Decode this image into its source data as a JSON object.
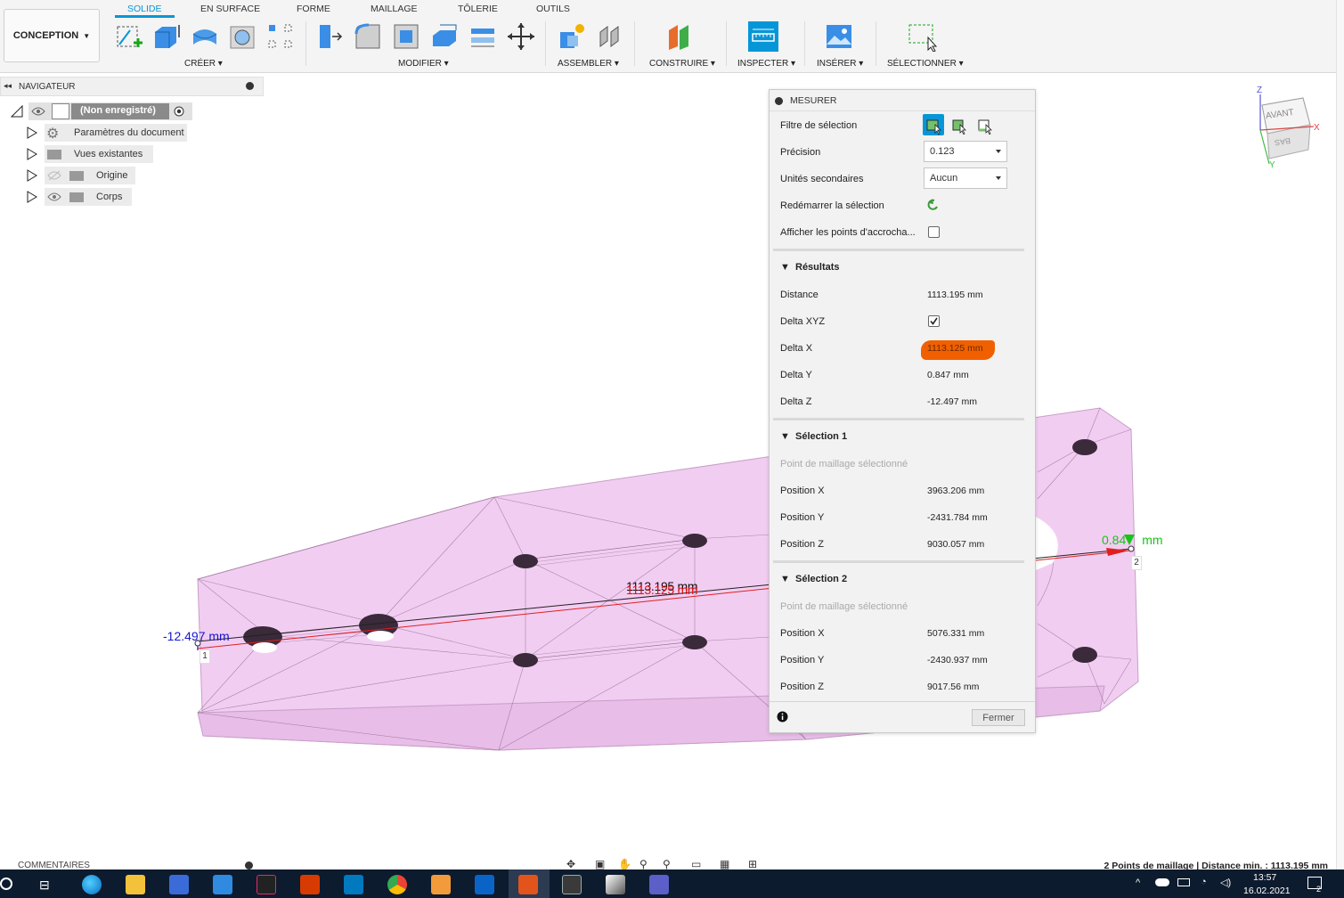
{
  "toolbar": {
    "workspace": "CONCEPTION",
    "tabs": [
      "SOLIDE",
      "EN SURFACE",
      "FORME",
      "MAILLAGE",
      "TÔLERIE",
      "OUTILS"
    ],
    "groups": {
      "create": "CRÉER",
      "modify": "MODIFIER",
      "assemble": "ASSEMBLER",
      "construct": "CONSTRUIRE",
      "inspect": "INSPECTER",
      "insert": "INSÉRER",
      "select": "SÉLECTIONNER"
    }
  },
  "navigator": {
    "title": "NAVIGATEUR",
    "root": "(Non enregistré)",
    "items": [
      "Paramètres du document",
      "Vues existantes",
      "Origine",
      "Corps"
    ]
  },
  "viewcube": {
    "front": "AVANT",
    "bottom": "BAS",
    "axis_z": "Z",
    "axis_x": "X",
    "axis_y": "Y"
  },
  "viewport": {
    "distance_label_front": "1113.195 mm",
    "distance_label_back": "1113.125 mm",
    "delta_z_label": "-12.497 mm",
    "delta_y_label": "0.847 mm",
    "delta_y_label_visible": "0.84",
    "delta_y_unit_visible": "mm",
    "point1": "1",
    "point2": "2"
  },
  "measure": {
    "title": "MESURER",
    "selection_filter": "Filtre de sélection",
    "precision_label": "Précision",
    "precision_value": "0.123",
    "secondary_units_label": "Unités secondaires",
    "secondary_units_value": "Aucun",
    "restart_selection": "Redémarrer la sélection",
    "show_snap_points": "Afficher les points d'accrocha...",
    "results_title": "Résultats",
    "results": [
      {
        "label": "Distance",
        "value": "1113.195 mm"
      },
      {
        "label": "Delta XYZ",
        "value": ""
      },
      {
        "label": "Delta X",
        "value": "1113.125 mm"
      },
      {
        "label": "Delta Y",
        "value": "0.847 mm"
      },
      {
        "label": "Delta Z",
        "value": "-12.497 mm"
      }
    ],
    "selection1_title": "Sélection 1",
    "selection1_type": "Point de maillage sélectionné",
    "selection1": [
      {
        "label": "Position X",
        "value": "3963.206 mm"
      },
      {
        "label": "Position Y",
        "value": "-2431.784 mm"
      },
      {
        "label": "Position Z",
        "value": "9030.057 mm"
      }
    ],
    "selection2_title": "Sélection 2",
    "selection2_type": "Point de maillage sélectionné",
    "selection2": [
      {
        "label": "Position X",
        "value": "5076.331 mm"
      },
      {
        "label": "Position Y",
        "value": "-2430.937 mm"
      },
      {
        "label": "Position Z",
        "value": "9017.56 mm"
      }
    ],
    "close": "Fermer"
  },
  "bottom": {
    "comments": "COMMENTAIRES",
    "status": "2 Points de maillage | Distance min. : 1113.195 mm"
  },
  "taskbar": {
    "time": "13:57",
    "date": "16.02.2021",
    "notifications": "2"
  },
  "colors": {
    "accent": "#0696d7",
    "mesh": "#f2cdf2",
    "highlight": "#f06000",
    "taskbar": "#0d1b2e"
  }
}
